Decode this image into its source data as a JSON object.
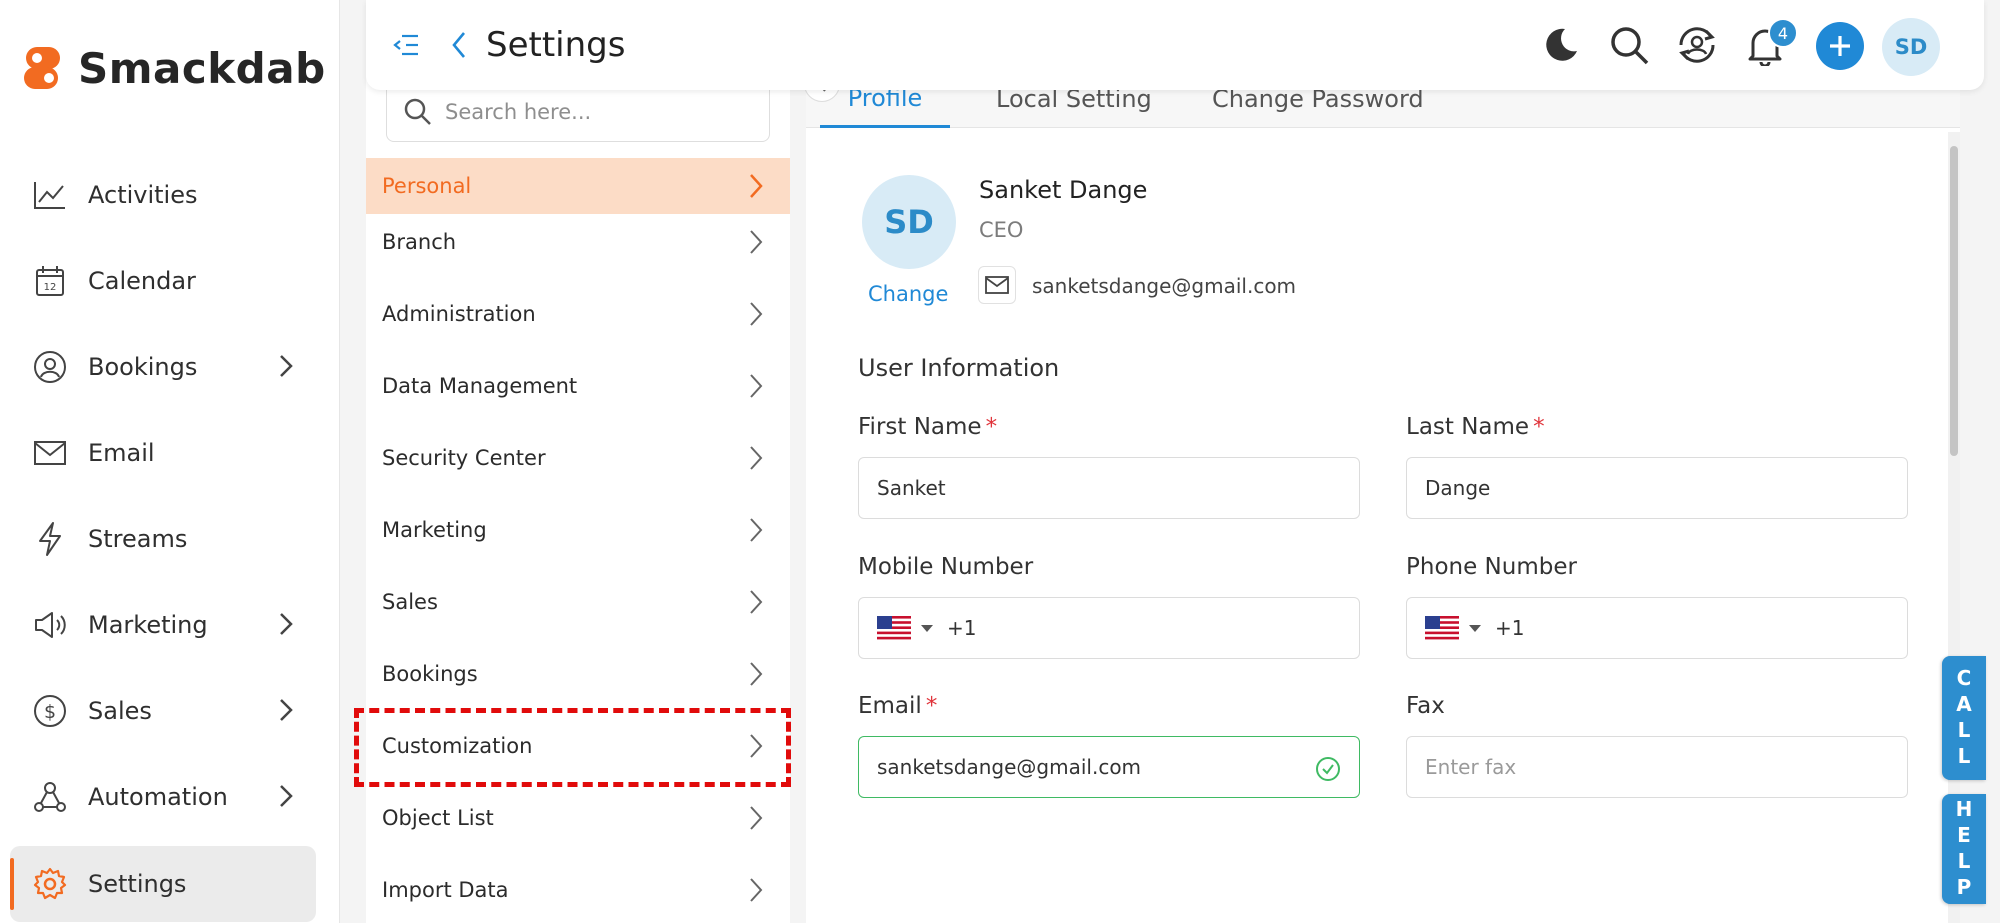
{
  "app": {
    "name": "Smackdab"
  },
  "sidebar": {
    "items": [
      {
        "label": "Activities",
        "icon": "activity-chart-icon",
        "has_submenu": false
      },
      {
        "label": "Calendar",
        "icon": "calendar-icon",
        "has_submenu": false
      },
      {
        "label": "Bookings",
        "icon": "user-circle-icon",
        "has_submenu": true
      },
      {
        "label": "Email",
        "icon": "mail-icon",
        "has_submenu": false
      },
      {
        "label": "Streams",
        "icon": "bolt-icon",
        "has_submenu": false
      },
      {
        "label": "Marketing",
        "icon": "megaphone-icon",
        "has_submenu": true
      },
      {
        "label": "Sales",
        "icon": "dollar-circle-icon",
        "has_submenu": true
      },
      {
        "label": "Automation",
        "icon": "automation-icon",
        "has_submenu": true
      },
      {
        "label": "Settings",
        "icon": "gear-icon",
        "has_submenu": false,
        "active": true
      }
    ]
  },
  "header": {
    "title": "Settings",
    "notification_count": "4",
    "user_initials": "SD"
  },
  "settings_menu": {
    "search_placeholder": "Search here...",
    "items": [
      {
        "label": "Personal",
        "active": true
      },
      {
        "label": "Branch"
      },
      {
        "label": "Administration"
      },
      {
        "label": "Data Management"
      },
      {
        "label": "Security Center"
      },
      {
        "label": "Marketing"
      },
      {
        "label": "Sales"
      },
      {
        "label": "Bookings"
      },
      {
        "label": "Customization",
        "highlighted": true
      },
      {
        "label": "Object List"
      },
      {
        "label": "Import Data"
      }
    ]
  },
  "tabs": [
    {
      "label": "Profile",
      "active": true
    },
    {
      "label": "Local Setting"
    },
    {
      "label": "Change Password"
    }
  ],
  "profile": {
    "initials": "SD",
    "change_label": "Change",
    "name": "Sanket Dange",
    "role": "CEO",
    "email": "sanketsdange@gmail.com"
  },
  "user_info": {
    "section_title": "User Information",
    "first_name": {
      "label": "First Name",
      "value": "Sanket",
      "required": true
    },
    "last_name": {
      "label": "Last Name",
      "value": "Dange",
      "required": true
    },
    "mobile": {
      "label": "Mobile Number",
      "code": "+1"
    },
    "phone": {
      "label": "Phone Number",
      "code": "+1"
    },
    "email": {
      "label": "Email",
      "value": "sanketsdange@gmail.com",
      "required": true,
      "valid": true
    },
    "fax": {
      "label": "Fax",
      "placeholder": "Enter fax"
    }
  },
  "side_buttons": {
    "call": "CALL",
    "help": "HELP"
  },
  "colors": {
    "accent": "#2089d6",
    "brand_orange": "#f26b21",
    "highlight_red": "#e10b0b"
  }
}
